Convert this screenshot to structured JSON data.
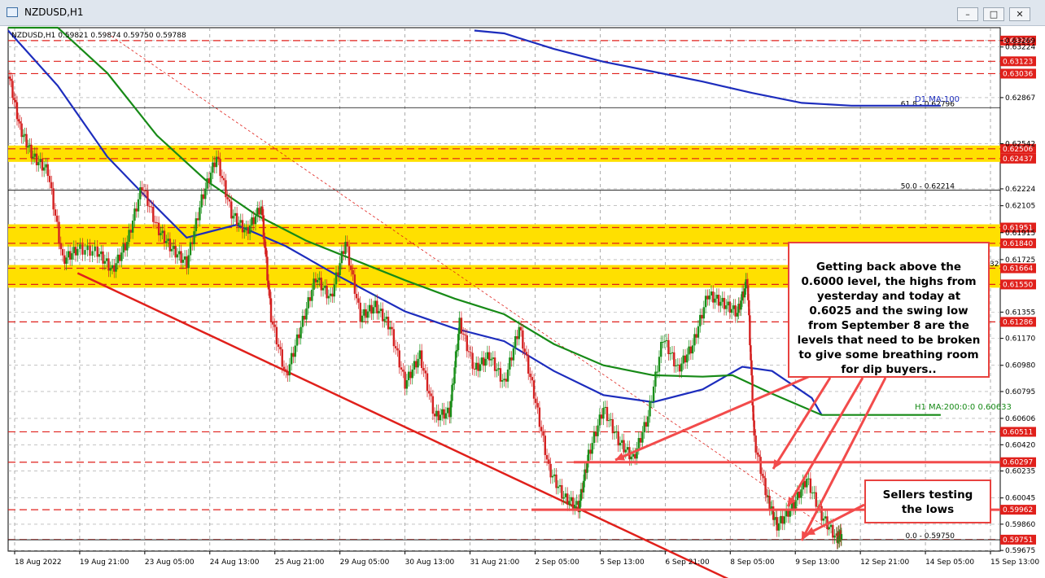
{
  "window": {
    "title": "NZDUSD,H1",
    "minimize_label": "–",
    "maximize_label": "□",
    "close_label": "✕"
  },
  "chart_data": {
    "type": "candlestick",
    "symbol_info": "NZDUSD,H1  0.59821 0.59874 0.59750 0.59788",
    "ylim": [
      0.5967,
      0.6336
    ],
    "y_ticks": [
      0.63269,
      0.63224,
      0.62867,
      0.62542,
      0.62224,
      0.62105,
      0.61915,
      0.61725,
      0.61355,
      0.6117,
      0.6098,
      0.60795,
      0.60606,
      0.6042,
      0.60235,
      0.60045,
      0.5986,
      0.59675
    ],
    "x_ticks": [
      "18 Aug 2022",
      "19 Aug 21:00",
      "23 Aug 05:00",
      "24 Aug 13:00",
      "25 Aug 21:00",
      "29 Aug 05:00",
      "30 Aug 13:00",
      "31 Aug 21:00",
      "2 Sep 05:00",
      "5 Sep 13:00",
      "6 Sep 21:00",
      "8 Sep 05:00",
      "9 Sep 13:00",
      "12 Sep 21:00",
      "14 Sep 05:00",
      "15 Sep 13:00"
    ],
    "price_levels": [
      {
        "value": 0.63269,
        "color": "#e0201b",
        "label": "0.63269"
      },
      {
        "value": 0.63123,
        "color": "#e0201b",
        "label": "0.63123"
      },
      {
        "value": 0.63036,
        "color": "#e0201b",
        "label": "0.63036"
      },
      {
        "value": 0.62506,
        "color": "#e0201b",
        "label": "0.62506"
      },
      {
        "value": 0.62437,
        "color": "#e0201b",
        "label": "0.62437"
      },
      {
        "value": 0.61951,
        "color": "#e0201b",
        "label": "0.61951"
      },
      {
        "value": 0.6184,
        "color": "#e0201b",
        "label": "0.61840"
      },
      {
        "value": 0.61664,
        "color": "#e0201b",
        "label": "0.61664"
      },
      {
        "value": 0.6155,
        "color": "#e0201b",
        "label": "0.61550"
      },
      {
        "value": 0.61286,
        "color": "#e0201b",
        "label": "0.61286"
      },
      {
        "value": 0.60511,
        "color": "#e0201b",
        "label": "0.60511"
      },
      {
        "value": 0.60297,
        "color": "#e0201b",
        "label": "0.60297"
      },
      {
        "value": 0.59962,
        "color": "#e0201b",
        "label": "0.59962"
      },
      {
        "value": 0.59751,
        "color": "#e0201b",
        "label": "0.59751"
      }
    ],
    "zones": [
      {
        "from": 0.62437,
        "to": 0.62506
      },
      {
        "from": 0.6184,
        "to": 0.61951
      },
      {
        "from": 0.6155,
        "to": 0.61664
      }
    ],
    "fib_levels": [
      {
        "value": 0.62796,
        "label": "61.8 - 0.62796"
      },
      {
        "value": 0.62214,
        "label": "50.0 - 0.62214"
      },
      {
        "value": 0.5975,
        "label": "0.0 - 0.59750"
      }
    ],
    "ma_labels": {
      "d1": "D1 MA:100",
      "h1": "H1 MA:200:0:0 0.60633",
      "partial": "32"
    },
    "moving_averages": [
      {
        "color": "#1d2dbd",
        "points": [
          [
            0,
            0.6334
          ],
          [
            0.05,
            0.6295
          ],
          [
            0.1,
            0.6245
          ],
          [
            0.14,
            0.6216
          ],
          [
            0.18,
            0.6188
          ],
          [
            0.23,
            0.6197
          ],
          [
            0.28,
            0.6182
          ],
          [
            0.33,
            0.6162
          ],
          [
            0.4,
            0.6136
          ],
          [
            0.45,
            0.6124
          ],
          [
            0.5,
            0.6115
          ],
          [
            0.55,
            0.6094
          ],
          [
            0.6,
            0.6077
          ],
          [
            0.65,
            0.6072
          ],
          [
            0.7,
            0.6081
          ],
          [
            0.74,
            0.6097
          ],
          [
            0.77,
            0.6094
          ],
          [
            0.81,
            0.6075
          ],
          [
            0.82,
            0.6063
          ]
        ]
      },
      {
        "color": "#178a17",
        "points": [
          [
            0,
            0.6392
          ],
          [
            0.05,
            0.6356
          ],
          [
            0.1,
            0.6304
          ],
          [
            0.15,
            0.626
          ],
          [
            0.2,
            0.6228
          ],
          [
            0.25,
            0.6204
          ],
          [
            0.3,
            0.6186
          ],
          [
            0.35,
            0.6172
          ],
          [
            0.4,
            0.6158
          ],
          [
            0.45,
            0.6145
          ],
          [
            0.5,
            0.6134
          ],
          [
            0.55,
            0.6113
          ],
          [
            0.6,
            0.6098
          ],
          [
            0.65,
            0.6091
          ],
          [
            0.7,
            0.609
          ],
          [
            0.73,
            0.6091
          ],
          [
            0.77,
            0.6078
          ],
          [
            0.82,
            0.6063
          ],
          [
            0.94,
            0.6063
          ]
        ]
      },
      {
        "color": "#1d2dbd",
        "points": [
          [
            0.47,
            0.6334
          ],
          [
            0.5,
            0.6332
          ],
          [
            0.55,
            0.6321
          ],
          [
            0.6,
            0.6312
          ],
          [
            0.65,
            0.6305
          ],
          [
            0.7,
            0.6298
          ],
          [
            0.75,
            0.629
          ],
          [
            0.8,
            0.6283
          ],
          [
            0.85,
            0.6281
          ],
          [
            0.94,
            0.6281
          ]
        ]
      }
    ],
    "price_path": [
      [
        0,
        0.6305
      ],
      [
        0.012,
        0.6265
      ],
      [
        0.025,
        0.6245
      ],
      [
        0.04,
        0.6235
      ],
      [
        0.055,
        0.6172
      ],
      [
        0.07,
        0.618
      ],
      [
        0.09,
        0.6178
      ],
      [
        0.105,
        0.6165
      ],
      [
        0.12,
        0.6185
      ],
      [
        0.135,
        0.6225
      ],
      [
        0.15,
        0.6195
      ],
      [
        0.165,
        0.618
      ],
      [
        0.18,
        0.617
      ],
      [
        0.195,
        0.6215
      ],
      [
        0.21,
        0.6245
      ],
      [
        0.225,
        0.6205
      ],
      [
        0.24,
        0.6192
      ],
      [
        0.255,
        0.621
      ],
      [
        0.265,
        0.6132
      ],
      [
        0.28,
        0.609
      ],
      [
        0.295,
        0.6125
      ],
      [
        0.31,
        0.616
      ],
      [
        0.325,
        0.6145
      ],
      [
        0.34,
        0.6185
      ],
      [
        0.355,
        0.6132
      ],
      [
        0.37,
        0.614
      ],
      [
        0.385,
        0.6125
      ],
      [
        0.4,
        0.6085
      ],
      [
        0.415,
        0.6105
      ],
      [
        0.43,
        0.6062
      ],
      [
        0.445,
        0.6065
      ],
      [
        0.455,
        0.6128
      ],
      [
        0.47,
        0.6095
      ],
      [
        0.485,
        0.6105
      ],
      [
        0.5,
        0.6085
      ],
      [
        0.515,
        0.6125
      ],
      [
        0.53,
        0.6078
      ],
      [
        0.545,
        0.6025
      ],
      [
        0.56,
        0.6005
      ],
      [
        0.575,
        0.5998
      ],
      [
        0.585,
        0.6035
      ],
      [
        0.6,
        0.6068
      ],
      [
        0.615,
        0.6045
      ],
      [
        0.63,
        0.6032
      ],
      [
        0.645,
        0.6062
      ],
      [
        0.66,
        0.6118
      ],
      [
        0.675,
        0.6095
      ],
      [
        0.69,
        0.6112
      ],
      [
        0.705,
        0.6148
      ],
      [
        0.72,
        0.6142
      ],
      [
        0.735,
        0.6135
      ],
      [
        0.745,
        0.6158
      ],
      [
        0.752,
        0.6045
      ],
      [
        0.765,
        0.6005
      ],
      [
        0.775,
        0.5985
      ],
      [
        0.79,
        0.5998
      ],
      [
        0.805,
        0.6018
      ],
      [
        0.82,
        0.5992
      ],
      [
        0.835,
        0.5976
      ],
      [
        0.84,
        0.5979
      ]
    ],
    "trendlines": [
      {
        "style": "solid",
        "color": "#e0201b",
        "from": [
          0.07,
          0.6163
        ],
        "to": [
          0.73,
          0.5946
        ]
      },
      {
        "style": "dashed",
        "color": "#e0201b",
        "from": [
          0.1,
          0.6332
        ],
        "to": [
          0.84,
          0.5976
        ]
      }
    ],
    "annotations": [
      {
        "text": "Getting back above the 0.6000 level, the highs from yesterday and today at  0.6025 and the swing low from September 8 are the levels that need to be broken to give some breathing room for dip buyers.."
      },
      {
        "text": "Sellers testing the lows"
      }
    ]
  }
}
